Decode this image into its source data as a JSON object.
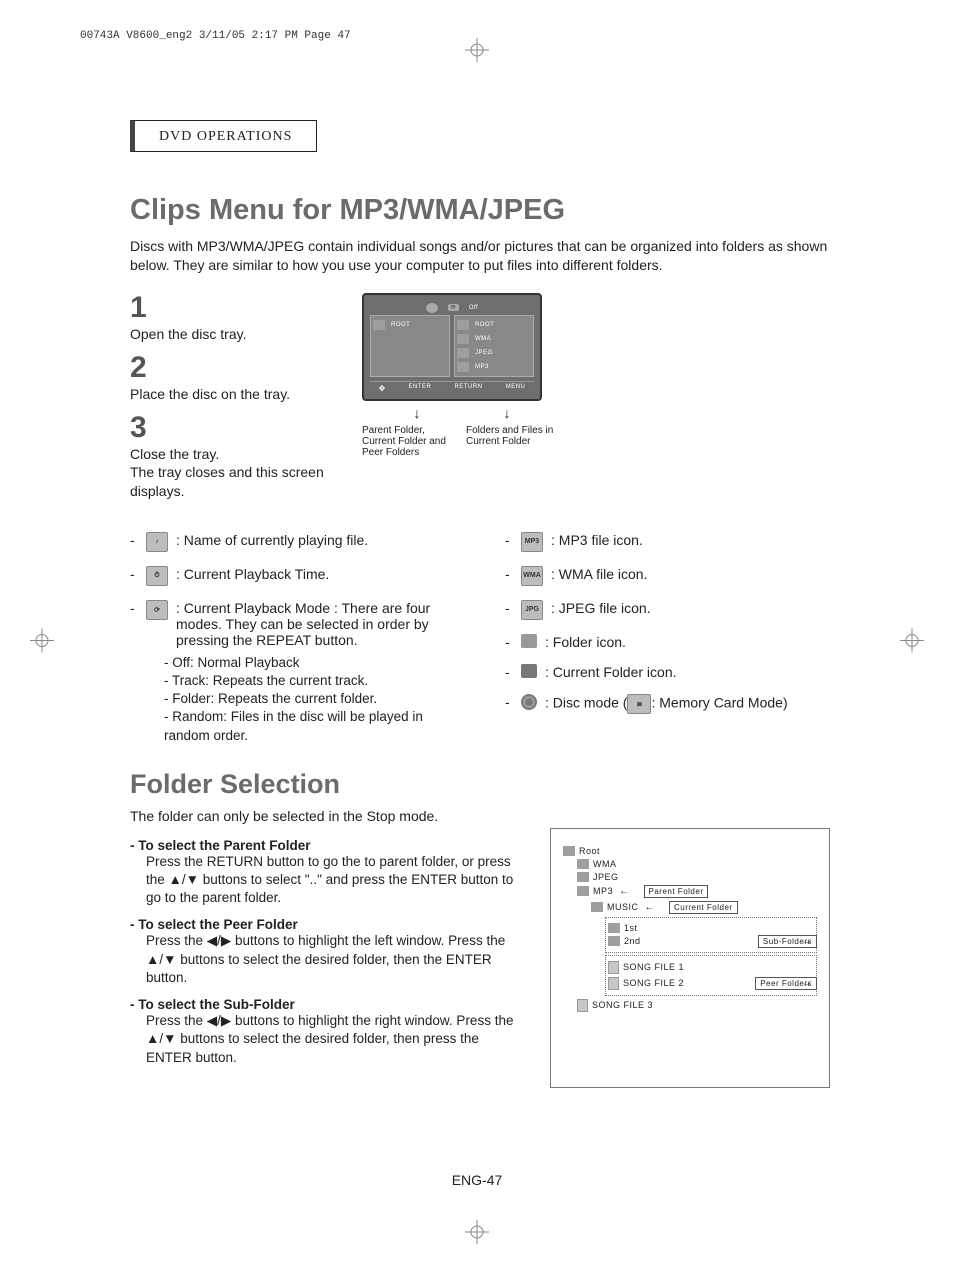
{
  "crop_mark": "00743A V8600_eng2  3/11/05  2:17 PM  Page 47",
  "section_label": "DVD OPERATIONS",
  "title": "Clips Menu for MP3/WMA/JPEG",
  "intro": "Discs with MP3/WMA/JPEG contain individual songs and/or pictures that can be organized into folders as shown below.  They are similar to how you use your computer to put files into different folders.",
  "steps": {
    "s1_num": "1",
    "s1_text": "Open the disc tray.",
    "s2_num": "2",
    "s2_text": "Place the disc on the tray.",
    "s3_num": "3",
    "s3_text": "Close the tray.\nThe tray closes and this screen displays."
  },
  "tv": {
    "off": "Off",
    "root": "ROOT",
    "items": [
      "ROOT",
      "WMA",
      "JPEG",
      "MP3"
    ],
    "bottom": [
      "ENTER",
      "RETURN",
      "MENU"
    ]
  },
  "diagram_captions": {
    "left": "Parent Folder, Current Folder and Peer Folders",
    "right": "Folders and Files in Current Folder"
  },
  "left_items": {
    "l1": ":  Name of currently playing file.",
    "l2": ":  Current Playback Time.",
    "l3": ": Current Playback Mode : There are four modes. They can be selected in order by pressing the REPEAT button.",
    "l3a": "- Off: Normal Playback",
    "l3b": "- Track: Repeats the current track.",
    "l3c": "- Folder: Repeats the current folder.",
    "l3d": "- Random: Files in the disc will be played in random order."
  },
  "right_items": {
    "r1": ": MP3 file icon.",
    "r2": ": WMA file icon.",
    "r3": ": JPEG file icon.",
    "r4": ": Folder icon.",
    "r5": ": Current Folder icon.",
    "r6a": ": Disc mode (",
    "r6b": ": Memory Card Mode)"
  },
  "subtitle": "Folder Selection",
  "folder_intro": "The folder can only be selected in the Stop mode.",
  "fs": {
    "a_lead": "- To select the Parent Folder",
    "a_body": "Press the RETURN button to go the to parent folder, or press the ▲/▼ buttons to select \"..\" and press the ENTER button to go to the parent folder.",
    "b_lead": "- To select the Peer Folder",
    "b_body": "Press the ◀/▶ buttons to highlight the left window. Press the ▲/▼ buttons to select the desired folder, then the ENTER button.",
    "c_lead": "- To select the Sub-Folder",
    "c_body": "Press the ◀/▶ buttons to highlight the right window. Press the ▲/▼ buttons to select the desired folder, then press the ENTER button."
  },
  "tree": {
    "root": "Root",
    "wma": "WMA",
    "jpeg": "JPEG",
    "mp3": "MP3",
    "music": "MUSIC",
    "first": "1st",
    "second": "2nd",
    "sf1": "SONG FILE 1",
    "sf2": "SONG FILE 2",
    "sf3": "SONG FILE 3",
    "lbl_parent": "Parent Folder",
    "lbl_current": "Current Folder",
    "lbl_sub": "Sub-Folders",
    "lbl_peer": "Peer Folders"
  },
  "page_num": "ENG-47"
}
